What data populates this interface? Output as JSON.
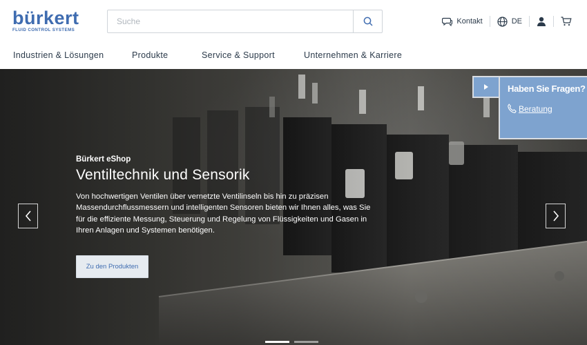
{
  "brand": {
    "name": "bürkert",
    "tagline": "FLUID CONTROL SYSTEMS",
    "color": "#3f6cb0"
  },
  "search": {
    "placeholder": "Suche",
    "value": ""
  },
  "utility": {
    "contact_label": "Kontakt",
    "language": "DE",
    "icons": [
      "chat-bubble-icon",
      "globe-icon",
      "user-icon",
      "cart-icon"
    ]
  },
  "nav": {
    "items": [
      "Industrien & Lösungen",
      "Produkte",
      "Service & Support",
      "Unternehmen & Karriere"
    ]
  },
  "hero": {
    "kicker": "Bürkert eShop",
    "title": "Ventiltechnik und Sensorik",
    "text": "Von hochwertigen Ventilen über vernetzte Ventilinseln bis hin zu präzisen Massendurchflussmessern und intelligenten Sensoren bieten wir Ihnen alles, was Sie für die effiziente Messung, Steuerung und Regelung von Flüssigkeiten und Gasen in Ihren Anlagen und Systemen benötigen.",
    "cta_label": "Zu den Produkten",
    "slides": 2,
    "active_slide": 1
  },
  "help": {
    "title": "Haben Sie Fragen?",
    "link_label": "Beratung",
    "panel_color": "#7ea3cf"
  }
}
